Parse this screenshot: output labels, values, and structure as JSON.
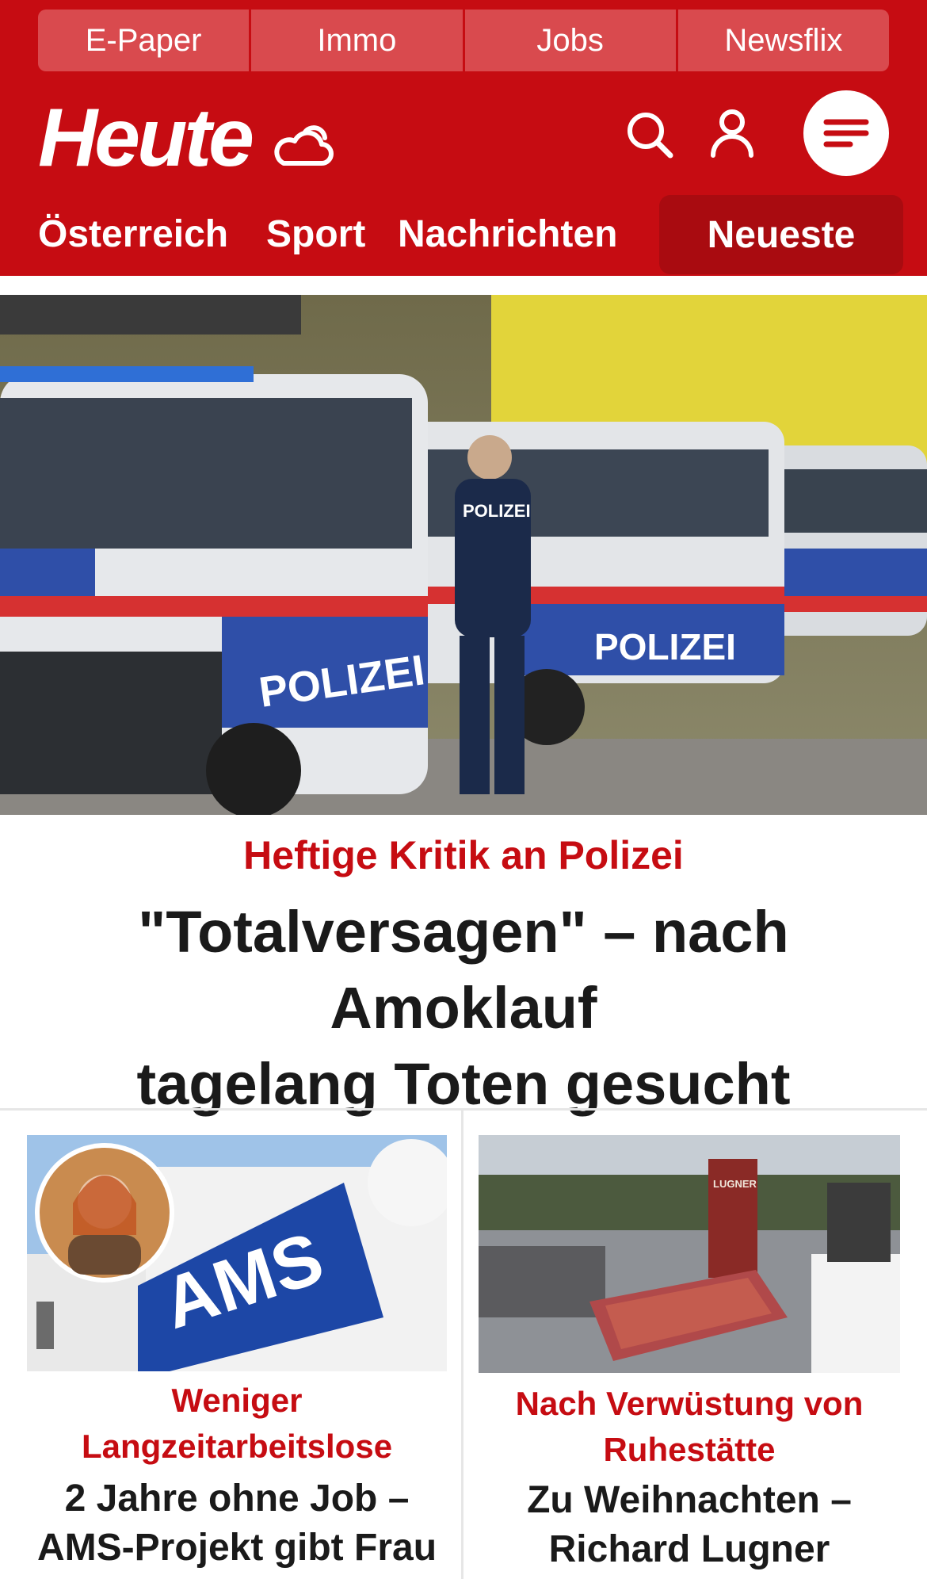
{
  "topnav": {
    "items": [
      "E-Paper",
      "Immo",
      "Jobs",
      "Newsflix"
    ]
  },
  "brand": {
    "logo_text": "Heute",
    "color": "#c60c12"
  },
  "icons": {
    "weather": "cloud-sun-icon",
    "search": "search-icon",
    "account": "user-icon",
    "menu": "hamburger-menu-icon"
  },
  "sections": {
    "oesterreich": "Österreich",
    "sport": "Sport",
    "nachrichten": "Nachrichten",
    "neueste": "Neueste"
  },
  "lead": {
    "kicker": "Heftige Kritik an Polizei",
    "headline_line1": "\"Totalversagen\" – nach Amoklauf",
    "headline_line2": "tagelang Toten gesucht"
  },
  "cards": [
    {
      "kicker_line1": "Weniger",
      "kicker_line2": "Langzeitarbeitslose",
      "title_line1": "2 Jahre ohne Job –",
      "title_line2": "AMS-Projekt gibt Frau",
      "image_sign_text": "AMS"
    },
    {
      "kicker_line1": "Nach Verwüstung von",
      "kicker_line2": "Ruhestätte",
      "title_line1": "Zu Weihnachten –",
      "title_line2": "Richard Lugner",
      "image_grave_text": "LUGNER"
    }
  ]
}
